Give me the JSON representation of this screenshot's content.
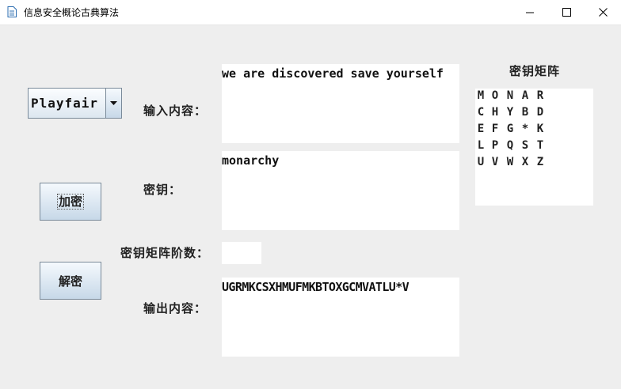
{
  "window": {
    "title": "信息安全概论古典算法"
  },
  "algorithm_select": {
    "value": "Playfair"
  },
  "labels": {
    "input": "输入内容：",
    "key": "密钥：",
    "order": "密钥矩阵阶数：",
    "output": "输出内容：",
    "matrix_title": "密钥矩阵"
  },
  "buttons": {
    "encrypt": "加密",
    "decrypt": "解密"
  },
  "fields": {
    "input": "we are discovered save yourself",
    "key": "monarchy",
    "order": "",
    "output": "UGRMKCSXHMUFMKBTOXGCMVATLU*V"
  },
  "matrix": [
    [
      "M",
      "O",
      "N",
      "A",
      "R"
    ],
    [
      "C",
      "H",
      "Y",
      "B",
      "D"
    ],
    [
      "E",
      "F",
      "G",
      "*",
      "K"
    ],
    [
      "L",
      "P",
      "Q",
      "S",
      "T"
    ],
    [
      "U",
      "V",
      "W",
      "X",
      "Z"
    ]
  ]
}
